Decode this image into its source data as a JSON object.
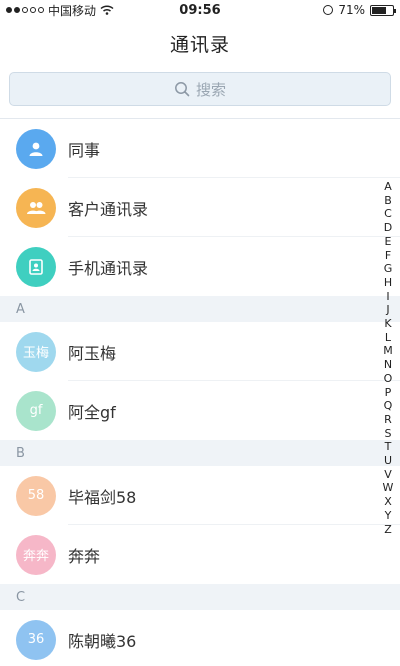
{
  "status_bar": {
    "carrier": "中国移动",
    "time": "09:56",
    "battery": "71%",
    "battery_level": 0.71
  },
  "nav": {
    "title": "通讯录"
  },
  "search": {
    "placeholder": "搜索"
  },
  "colors": {
    "blue": "#5aa9ef",
    "orange": "#f6b553",
    "teal": "#3fcfc0",
    "light_blue": "#9fd8ee",
    "light_green": "#a9e4cc",
    "peach": "#f9c8a6",
    "pink": "#f6b7c8",
    "sky": "#8fc3f1"
  },
  "shortcuts": [
    {
      "label": "同事",
      "icon": "person-icon"
    },
    {
      "label": "客户通讯录",
      "icon": "group-icon"
    },
    {
      "label": "手机通讯录",
      "icon": "phonebook-icon"
    }
  ],
  "sections": [
    {
      "letter": "A",
      "contacts": [
        {
          "avatar": "玉梅",
          "name": "阿玉梅"
        },
        {
          "avatar": "gf",
          "name": "阿全gf"
        }
      ]
    },
    {
      "letter": "B",
      "contacts": [
        {
          "avatar": "58",
          "name": "毕福剑58"
        },
        {
          "avatar": "奔奔",
          "name": "奔奔"
        }
      ]
    },
    {
      "letter": "C",
      "contacts": [
        {
          "avatar": "36",
          "name": "陈朝曦36"
        }
      ]
    }
  ],
  "index": [
    "A",
    "B",
    "C",
    "D",
    "E",
    "F",
    "G",
    "H",
    "I",
    "J",
    "K",
    "L",
    "M",
    "N",
    "O",
    "P",
    "Q",
    "R",
    "S",
    "T",
    "U",
    "V",
    "W",
    "X",
    "Y",
    "Z"
  ]
}
